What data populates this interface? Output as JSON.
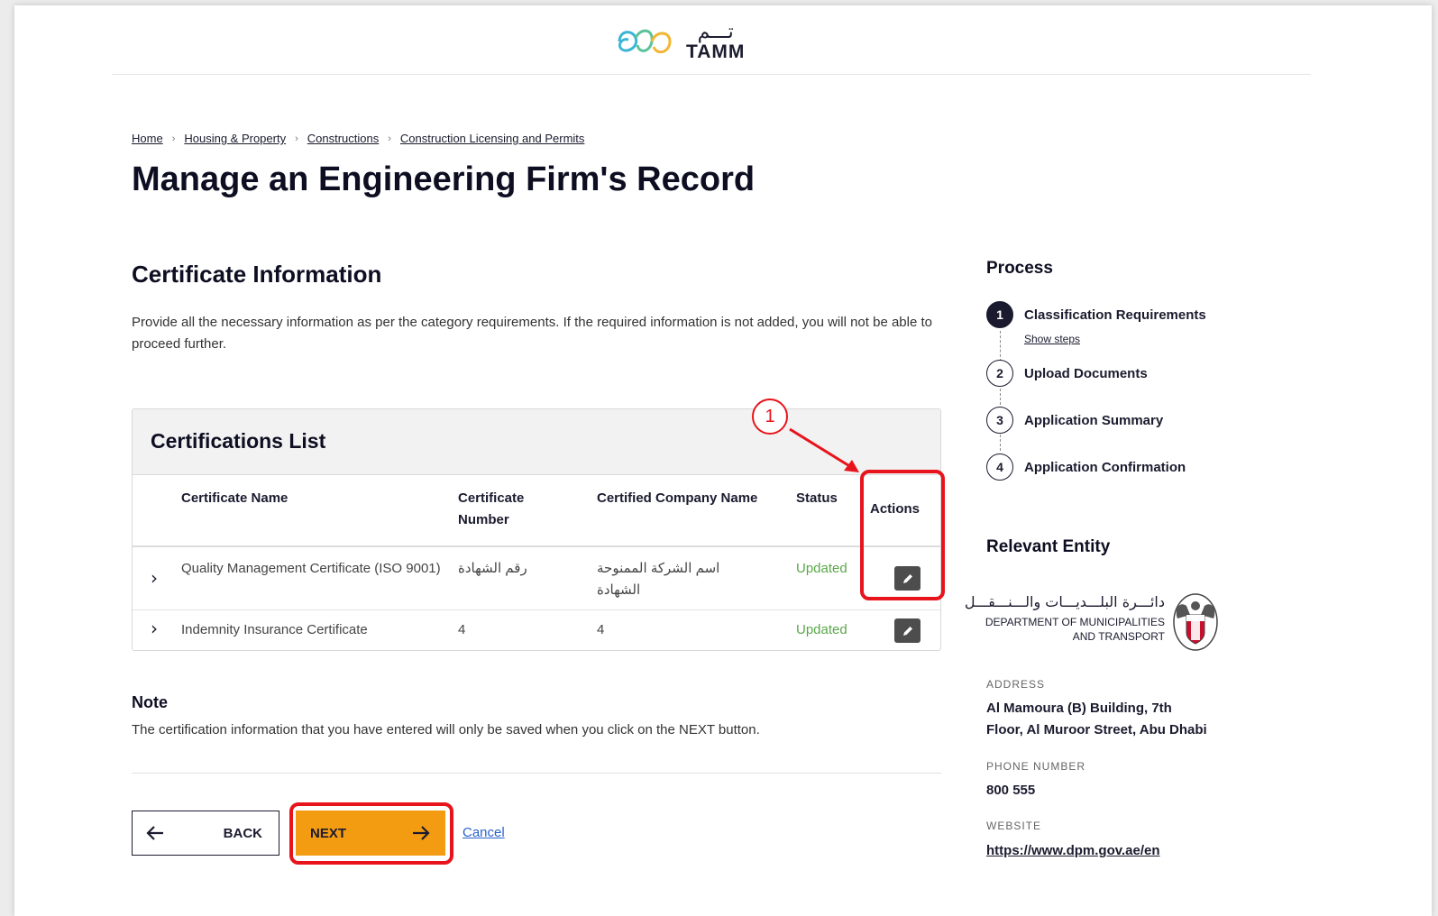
{
  "header": {
    "logo_arabic": "تـــم",
    "logo_text": "TAMM"
  },
  "breadcrumb": [
    "Home",
    "Housing & Property",
    "Constructions",
    "Construction Licensing and Permits"
  ],
  "page_title": "Manage an Engineering Firm's Record",
  "section": {
    "title": "Certificate Information",
    "intro": "Provide all the necessary information as per the category requirements. If the required information is not added, you will not be able to proceed further."
  },
  "certifications": {
    "title": "Certifications List",
    "columns": [
      "Certificate Name",
      "Certificate Number",
      "Certified Company Name",
      "Status",
      "Actions"
    ],
    "rows": [
      {
        "name": "Quality Management Certificate (ISO 9001)",
        "number": "رقم الشهادة",
        "company": "اسم الشركة الممنوحة الشهادة",
        "status": "Updated"
      },
      {
        "name": "Indemnity Insurance Certificate",
        "number": "4",
        "company": "4",
        "status": "Updated"
      }
    ]
  },
  "note": {
    "title": "Note",
    "text": "The certification information that you have entered will only be saved when you click on the NEXT button."
  },
  "actions": {
    "back": "BACK",
    "next": "NEXT",
    "cancel": "Cancel"
  },
  "callout_number": "1",
  "process": {
    "title": "Process",
    "steps": [
      {
        "num": "1",
        "label": "Classification Requirements",
        "active": true
      },
      {
        "num": "2",
        "label": "Upload Documents",
        "active": false
      },
      {
        "num": "3",
        "label": "Application Summary",
        "active": false
      },
      {
        "num": "4",
        "label": "Application Confirmation",
        "active": false
      }
    ],
    "show_steps": "Show steps"
  },
  "entity": {
    "title": "Relevant Entity",
    "name_ar": "دائـــرة البلـــديـــات والـــنـــقـــل",
    "name_en_line1": "DEPARTMENT OF MUNICIPALITIES",
    "name_en_line2": "AND TRANSPORT",
    "address_label": "ADDRESS",
    "address_line1": "Al Mamoura (B) Building, 7th",
    "address_line2": "Floor, Al Muroor Street, Abu Dhabi",
    "phone_label": "PHONE NUMBER",
    "phone": "800 555",
    "website_label": "WEBSITE",
    "website": "https://www.dpm.gov.ae/en"
  },
  "colors": {
    "accent": "#f39c12",
    "highlight": "#e8141b",
    "status_green": "#5aa84a"
  }
}
